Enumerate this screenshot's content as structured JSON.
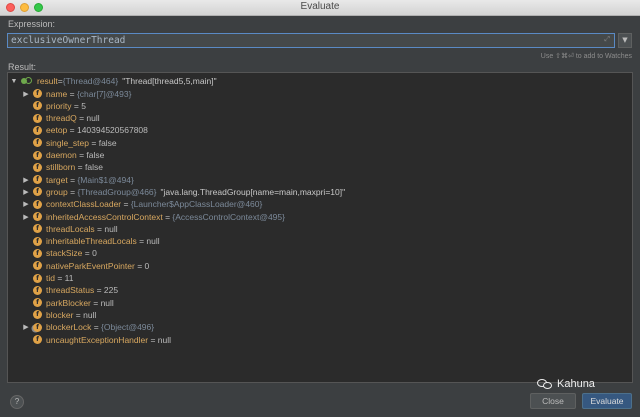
{
  "window": {
    "title": "Evaluate",
    "expression_label": "Expression:",
    "expression_value": "exclusiveOwnerThread",
    "expand_glyph": "⤢",
    "dropdown_glyph": "▼",
    "hint": "Use ⇧⌘⏎ to add to Watches",
    "result_label": "Result:",
    "help_glyph": "?",
    "close_label": "Close",
    "evaluate_label": "Evaluate",
    "watermark_text": "Kahuna"
  },
  "tree": {
    "root": {
      "name": "result",
      "ref": "{Thread@464}",
      "value": "\"Thread[thread5,5,main]\""
    },
    "fields": [
      {
        "name": "name",
        "ref": "{char[7]@493}",
        "value": "",
        "expandable": true
      },
      {
        "name": "priority",
        "ref": "",
        "value": "5",
        "expandable": false
      },
      {
        "name": "threadQ",
        "ref": "",
        "value": "null",
        "expandable": false
      },
      {
        "name": "eetop",
        "ref": "",
        "value": "140394520567808",
        "expandable": false
      },
      {
        "name": "single_step",
        "ref": "",
        "value": "false",
        "expandable": false
      },
      {
        "name": "daemon",
        "ref": "",
        "value": "false",
        "expandable": false
      },
      {
        "name": "stillborn",
        "ref": "",
        "value": "false",
        "expandable": false
      },
      {
        "name": "target",
        "ref": "{Main$1@494}",
        "value": "",
        "expandable": true
      },
      {
        "name": "group",
        "ref": "{ThreadGroup@466}",
        "value": "\"java.lang.ThreadGroup[name=main,maxpri=10]\"",
        "expandable": true
      },
      {
        "name": "contextClassLoader",
        "ref": "{Launcher$AppClassLoader@460}",
        "value": "",
        "expandable": true
      },
      {
        "name": "inheritedAccessControlContext",
        "ref": "{AccessControlContext@495}",
        "value": "",
        "expandable": true
      },
      {
        "name": "threadLocals",
        "ref": "",
        "value": "null",
        "expandable": false
      },
      {
        "name": "inheritableThreadLocals",
        "ref": "",
        "value": "null",
        "expandable": false
      },
      {
        "name": "stackSize",
        "ref": "",
        "value": "0",
        "expandable": false
      },
      {
        "name": "nativeParkEventPointer",
        "ref": "",
        "value": "0",
        "expandable": false
      },
      {
        "name": "tid",
        "ref": "",
        "value": "11",
        "expandable": false
      },
      {
        "name": "threadStatus",
        "ref": "",
        "value": "225",
        "expandable": false
      },
      {
        "name": "parkBlocker",
        "ref": "",
        "value": "null",
        "expandable": false
      },
      {
        "name": "blocker",
        "ref": "",
        "value": "null",
        "expandable": false
      },
      {
        "name": "blockerLock",
        "ref": "{Object@496}",
        "value": "",
        "expandable": true
      },
      {
        "name": "uncaughtExceptionHandler",
        "ref": "",
        "value": "null",
        "expandable": false
      }
    ],
    "field_icon_letter": "f",
    "equals": " = ",
    "expand_arrow": "▶",
    "root_arrow": "▼"
  },
  "colors": {
    "field_icon": "#e0a247",
    "field_name": "#d8a860",
    "ref_text": "#7c8a9a",
    "evaluate_button": "#365880"
  }
}
